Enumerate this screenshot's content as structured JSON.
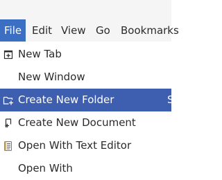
{
  "menubar": {
    "file": "File",
    "edit": "Edit",
    "view": "View",
    "go": "Go",
    "bookmarks": "Bookmarks"
  },
  "file_menu": {
    "new_tab": "New Tab",
    "new_window": "New Window",
    "create_new_folder": "Create New Folder",
    "create_new_folder_shortcut": "S",
    "create_new_document": "Create New Document",
    "open_with_text_editor": "Open With Text Editor",
    "open_with": "Open With"
  },
  "colors": {
    "accent": "#3b6fc4",
    "highlight": "#3e5fb0",
    "menubar_bg": "#f5f5f5"
  }
}
